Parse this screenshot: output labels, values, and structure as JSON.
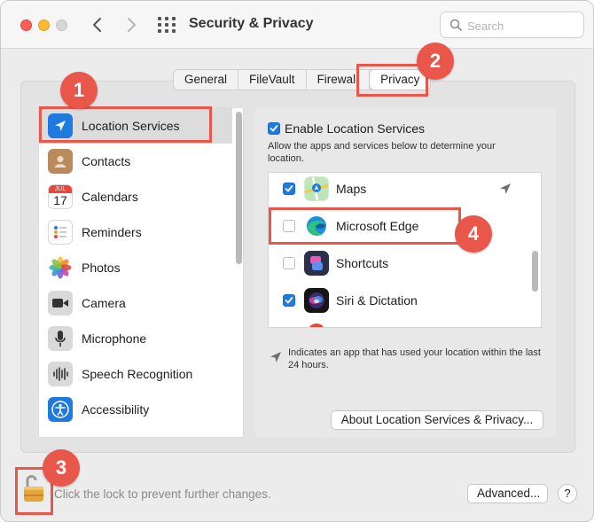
{
  "window": {
    "title": "Security & Privacy"
  },
  "search": {
    "placeholder": "Search"
  },
  "tabs": [
    {
      "label": "General"
    },
    {
      "label": "FileVault"
    },
    {
      "label": "Firewall"
    },
    {
      "label": "Privacy",
      "active": true
    }
  ],
  "sidebar": {
    "items": [
      {
        "label": "Location Services",
        "icon": "location-arrow-icon",
        "selected": true
      },
      {
        "label": "Contacts",
        "icon": "contacts-icon"
      },
      {
        "label": "Calendars",
        "icon": "calendar-icon",
        "month": "JUL",
        "day": "17"
      },
      {
        "label": "Reminders",
        "icon": "reminders-icon"
      },
      {
        "label": "Photos",
        "icon": "photos-icon"
      },
      {
        "label": "Camera",
        "icon": "camera-icon"
      },
      {
        "label": "Microphone",
        "icon": "microphone-icon"
      },
      {
        "label": "Speech Recognition",
        "icon": "speech-recognition-icon"
      },
      {
        "label": "Accessibility",
        "icon": "accessibility-icon"
      }
    ]
  },
  "location": {
    "enable_label": "Enable Location Services",
    "enabled": true,
    "description": "Allow the apps and services below to determine your location.",
    "apps": [
      {
        "label": "Maps",
        "checked": true,
        "icon": "maps-icon",
        "recent": true
      },
      {
        "label": "Microsoft Edge",
        "checked": false,
        "icon": "microsoft-edge-icon"
      },
      {
        "label": "Shortcuts",
        "checked": false,
        "icon": "shortcuts-icon"
      },
      {
        "label": "Siri & Dictation",
        "checked": true,
        "icon": "siri-icon"
      }
    ],
    "note": "Indicates an app that has used your location within the last 24 hours.",
    "about_button": "About Location Services & Privacy..."
  },
  "footer": {
    "lock_text": "Click the lock to prevent further changes.",
    "advanced_button": "Advanced...",
    "help_button": "?"
  },
  "annotations": {
    "badges": [
      "1",
      "2",
      "3",
      "4"
    ]
  },
  "colors": {
    "accent": "#1f7ae0",
    "annotation": "#e8574a",
    "selected_row": "#dcdcdc"
  }
}
